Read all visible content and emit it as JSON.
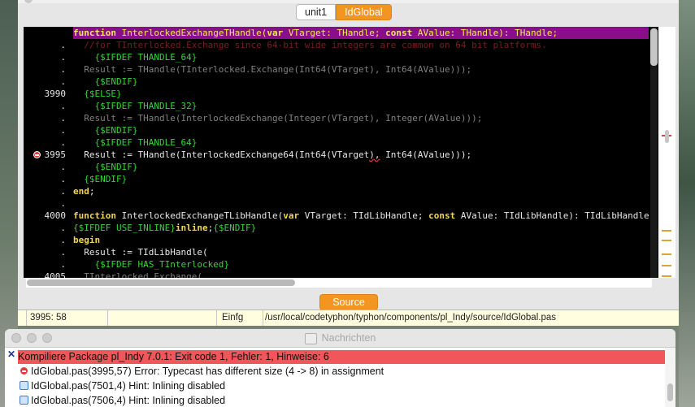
{
  "editor": {
    "tabs": [
      {
        "label": "unit1",
        "active": false
      },
      {
        "label": "IdGlobal",
        "active": true
      }
    ],
    "gutter": [
      {
        "text": "",
        "breakpoint": false
      },
      {
        "text": ".",
        "breakpoint": false
      },
      {
        "text": ".",
        "breakpoint": false
      },
      {
        "text": ".",
        "breakpoint": false
      },
      {
        "text": ".",
        "breakpoint": false
      },
      {
        "text": "3990",
        "breakpoint": false
      },
      {
        "text": ".",
        "breakpoint": false
      },
      {
        "text": ".",
        "breakpoint": false
      },
      {
        "text": ".",
        "breakpoint": false
      },
      {
        "text": ".",
        "breakpoint": false
      },
      {
        "text": "3995",
        "breakpoint": true
      },
      {
        "text": ".",
        "breakpoint": false
      },
      {
        "text": ".",
        "breakpoint": false
      },
      {
        "text": ".",
        "breakpoint": false
      },
      {
        "text": ".",
        "breakpoint": false
      },
      {
        "text": "4000",
        "breakpoint": false
      },
      {
        "text": ".",
        "breakpoint": false
      },
      {
        "text": ".",
        "breakpoint": false
      },
      {
        "text": ".",
        "breakpoint": false
      },
      {
        "text": ".",
        "breakpoint": false
      },
      {
        "text": "4005",
        "breakpoint": false
      }
    ],
    "code_lines": [
      {
        "highlight": true,
        "tokens": [
          {
            "t": "function",
            "c": "kw"
          },
          {
            "t": " InterlockedExchangeTHandle(",
            "c": ""
          },
          {
            "t": "var",
            "c": "kw"
          },
          {
            "t": " VTarget: THandle; ",
            "c": ""
          },
          {
            "t": "const",
            "c": "kw"
          },
          {
            "t": " AValue: THandle): THandle;",
            "c": ""
          }
        ]
      },
      {
        "highlight": false,
        "tokens": [
          {
            "t": "  //for TInterlocked.Exchange since 64-bit wide integers are common on 64 bit platforms.",
            "c": "com"
          }
        ]
      },
      {
        "highlight": false,
        "tokens": [
          {
            "t": "    {$IFDEF THANDLE_64}",
            "c": "dir"
          }
        ]
      },
      {
        "highlight": false,
        "tokens": [
          {
            "t": "  Result := THandle(TInterlocked.Exchange(Int64(VTarget), Int64(AValue)));",
            "c": "dim"
          }
        ]
      },
      {
        "highlight": false,
        "tokens": [
          {
            "t": "    {$ENDIF}",
            "c": "dir"
          }
        ]
      },
      {
        "highlight": false,
        "tokens": [
          {
            "t": "  {$ELSE}",
            "c": "dir"
          }
        ]
      },
      {
        "highlight": false,
        "tokens": [
          {
            "t": "    {$IFDEF THANDLE_32}",
            "c": "dir"
          }
        ]
      },
      {
        "highlight": false,
        "tokens": [
          {
            "t": "  Result := THandle(InterlockedExchange(Integer(VTarget), Integer(AValue)));",
            "c": "dim"
          }
        ]
      },
      {
        "highlight": false,
        "tokens": [
          {
            "t": "    {$ENDIF}",
            "c": "dir"
          }
        ]
      },
      {
        "highlight": false,
        "tokens": [
          {
            "t": "    {$IFDEF THANDLE_64}",
            "c": "dir"
          }
        ]
      },
      {
        "highlight": false,
        "tokens": [
          {
            "t": "  Result := THandle(InterlockedExchange64(Int64(VTarget",
            "c": ""
          },
          {
            "t": "),",
            "c": "err"
          },
          {
            "t": " Int64(AValue)));",
            "c": ""
          }
        ]
      },
      {
        "highlight": false,
        "tokens": [
          {
            "t": "    {$ENDIF}",
            "c": "dir"
          }
        ]
      },
      {
        "highlight": false,
        "tokens": [
          {
            "t": "  {$ENDIF}",
            "c": "dir"
          }
        ]
      },
      {
        "highlight": false,
        "tokens": [
          {
            "t": "end",
            "c": "kw"
          },
          {
            "t": ";",
            "c": ""
          }
        ]
      },
      {
        "highlight": false,
        "tokens": [
          {
            "t": "",
            "c": ""
          }
        ]
      },
      {
        "highlight": false,
        "tokens": [
          {
            "t": "function",
            "c": "kw"
          },
          {
            "t": " InterlockedExchangeTLibHandle(",
            "c": ""
          },
          {
            "t": "var",
            "c": "kw"
          },
          {
            "t": " VTarget: TIdLibHandle; ",
            "c": ""
          },
          {
            "t": "const",
            "c": "kw"
          },
          {
            "t": " AValue: TIdLibHandle): TIdLibHandle;",
            "c": ""
          }
        ]
      },
      {
        "highlight": false,
        "tokens": [
          {
            "t": "{$IFDEF USE_INLINE}",
            "c": "dir"
          },
          {
            "t": "inline",
            "c": "kw"
          },
          {
            "t": ";",
            "c": ""
          },
          {
            "t": "{$ENDIF}",
            "c": "dir"
          }
        ]
      },
      {
        "highlight": false,
        "tokens": [
          {
            "t": "begin",
            "c": "kw"
          }
        ]
      },
      {
        "highlight": false,
        "tokens": [
          {
            "t": "  Result := TIdLibHandle(",
            "c": ""
          }
        ]
      },
      {
        "highlight": false,
        "tokens": [
          {
            "t": "    {$IFDEF HAS_TInterlocked}",
            "c": "dir"
          }
        ]
      },
      {
        "highlight": false,
        "tokens": [
          {
            "t": "  TInterlocked.Exchange(",
            "c": "dim"
          }
        ]
      }
    ],
    "source_tab": "Source",
    "status": {
      "cursor": "3995: 58",
      "mode": "Einfg",
      "path": "/usr/local/codetyphon/typhon/components/pl_Indy/source/IdGlobal.pas"
    }
  },
  "messages": {
    "title": "Nachrichten",
    "items": [
      {
        "text": "Kompiliere Package pl_Indy 7.0.1: Exit code 1, Fehler: 1, Hinweise: 6",
        "kind": "summary"
      },
      {
        "text": "IdGlobal.pas(3995,57) Error: Typecast has different size (4 -> 8) in assignment",
        "kind": "error"
      },
      {
        "text": "IdGlobal.pas(7501,4) Hint: Inlining disabled",
        "kind": "hint"
      },
      {
        "text": "IdGlobal.pas(7506,4) Hint: Inlining disabled",
        "kind": "hint"
      }
    ]
  },
  "colors": {
    "accent": "#f39521",
    "highlight_line": "#8a0e8a",
    "error_row": "#f0565a",
    "status_bg": "#ffffdf"
  }
}
